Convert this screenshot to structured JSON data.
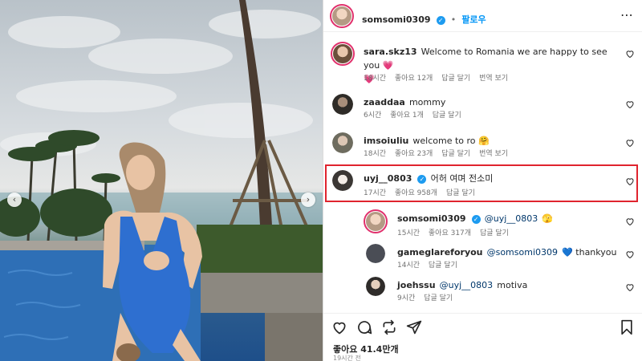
{
  "post": {
    "author": "somsomi0309",
    "follow_separator": "•",
    "follow_label": "팔로우",
    "more_label": "⋯"
  },
  "comments": [
    {
      "username": "sara.skz13",
      "text": "Welcome to Romania we are happy to see you 💗",
      "text_end": "💗",
      "time": "18시간",
      "likes": "좋아요 12개",
      "reply": "답글 달기",
      "translate": "번역 보기"
    },
    {
      "username": "zaaddaa",
      "text": "mommy",
      "time": "6시간",
      "likes": "좋아요 1개",
      "reply": "답글 달기"
    },
    {
      "username": "imsoiuliu",
      "text": "welcome to ro 🤗",
      "time": "18시간",
      "likes": "좋아요 23개",
      "reply": "답글 달기",
      "translate": "번역 보기"
    },
    {
      "username": "uyj__0803",
      "text": "어허 여며 전소미",
      "time": "17시간",
      "likes": "좋아요 958개",
      "reply": "답글 달기"
    }
  ],
  "replies": [
    {
      "username": "somsomi0309",
      "mention": "@uyj__0803",
      "text": "🫣",
      "time": "15시간",
      "likes": "좋아요 317개",
      "reply": "답글 달기"
    },
    {
      "username": "gameglareforyou",
      "mention": "@somsomi0309",
      "text": "💙 thankyou",
      "time": "14시간",
      "reply": "답글 달기"
    },
    {
      "username": "joehssu",
      "mention": "@uyj__0803",
      "text": "motiva",
      "time": "9시간",
      "reply": "답글 달기"
    }
  ],
  "footer": {
    "likes": "좋아요 41.4만개",
    "time": "19시간 전"
  },
  "nav": {
    "prev": "‹",
    "next": "›"
  },
  "icons": [
    "heart-icon",
    "comment-icon",
    "share-icon",
    "send-icon",
    "save-icon",
    "verified-icon",
    "more-icon"
  ],
  "colors": {
    "accent": "#0095f6",
    "highlight_border": "#e0242e",
    "verified": "#1d9bf0",
    "mention": "#00376b"
  }
}
